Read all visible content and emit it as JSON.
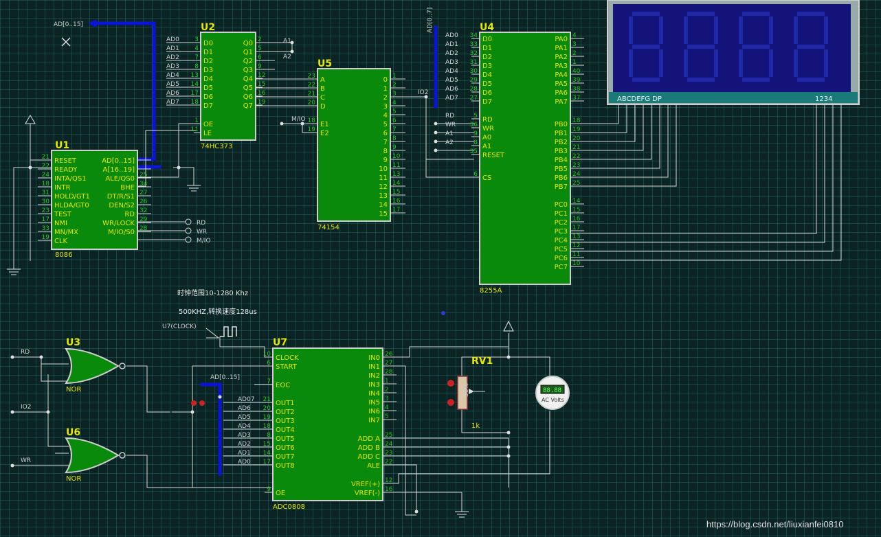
{
  "watermark": "https://blog.csdn.net/liuxianfei0810",
  "notes": {
    "clock_range": "时钟范围10-1280 Khz",
    "conversion": "500KHZ,转换速度128us"
  },
  "labels": {
    "bus_top_left": "AD[0..15]",
    "bus_adc": "AD[0..15]",
    "bus_u4": "AD[0..7]",
    "clock_src": "U7(CLOCK)",
    "io2_u5": "IO2",
    "io2_left": "IO2",
    "rd_left": "RD",
    "wr_left": "WR",
    "mio_u5": "M/IO",
    "a1_u2": "A1",
    "a2_u2": "A2",
    "rd_u1": "RD",
    "wr_u1": "WR",
    "mio_u1": "M/IO"
  },
  "u1": {
    "ref": "U1",
    "part": "8086",
    "left": [
      [
        "RESET",
        "21"
      ],
      [
        "READY",
        "22"
      ],
      [
        "INTA/QS1",
        "24"
      ],
      [
        "INTR",
        "18"
      ],
      [
        "HOLD/GT1",
        "31"
      ],
      [
        "HLDA/GT0",
        "30"
      ],
      [
        "TEST",
        "23"
      ],
      [
        "NMI",
        "17"
      ],
      [
        "MN/MX",
        "33"
      ],
      [
        "CLK",
        "19"
      ]
    ],
    "right": [
      [
        "AD[0..15]",
        ""
      ],
      [
        "A[16..19]",
        ""
      ],
      [
        "ALE/QS0",
        "25"
      ],
      [
        "BHE",
        "34"
      ],
      [
        "DT/R/S1",
        "27"
      ],
      [
        "DEN/S2",
        "26"
      ],
      [
        "RD",
        "32"
      ],
      [
        "WR/LOCK",
        "29"
      ],
      [
        "M/IO/S0",
        "28"
      ]
    ]
  },
  "u2": {
    "ref": "U2",
    "part": "74HC373",
    "left": [
      [
        "D0",
        "3",
        "AD0"
      ],
      [
        "D1",
        "4",
        "AD1"
      ],
      [
        "D2",
        "7",
        "AD2"
      ],
      [
        "D3",
        "8",
        "AD3"
      ],
      [
        "D4",
        "13",
        "AD4"
      ],
      [
        "D5",
        "14",
        "AD5"
      ],
      [
        "D6",
        "17",
        "AD6"
      ],
      [
        "D7",
        "18",
        "AD7"
      ]
    ],
    "right": [
      [
        "Q0",
        "2"
      ],
      [
        "Q1",
        "5"
      ],
      [
        "Q2",
        "6"
      ],
      [
        "Q3",
        "9"
      ],
      [
        "Q4",
        "12"
      ],
      [
        "Q5",
        "15"
      ],
      [
        "Q6",
        "16"
      ],
      [
        "Q7",
        "19"
      ]
    ],
    "ctrl": [
      [
        "OE",
        "1"
      ],
      [
        "LE",
        "11"
      ]
    ]
  },
  "u5": {
    "ref": "U5",
    "part": "74154",
    "left": [
      [
        "A",
        "23"
      ],
      [
        "B",
        "22"
      ],
      [
        "C",
        "21"
      ],
      [
        "D",
        "20"
      ],
      [
        "E1",
        "18"
      ],
      [
        "E2",
        "19"
      ]
    ],
    "right": [
      [
        "0",
        "1"
      ],
      [
        "1",
        "2"
      ],
      [
        "2",
        "3"
      ],
      [
        "3",
        "4"
      ],
      [
        "4",
        "5"
      ],
      [
        "5",
        "6"
      ],
      [
        "6",
        "7"
      ],
      [
        "7",
        "8"
      ],
      [
        "8",
        "9"
      ],
      [
        "9",
        "10"
      ],
      [
        "10",
        "11"
      ],
      [
        "11",
        "13"
      ],
      [
        "12",
        "14"
      ],
      [
        "13",
        "15"
      ],
      [
        "14",
        "16"
      ],
      [
        "15",
        "17"
      ]
    ]
  },
  "u4": {
    "ref": "U4",
    "part": "8255A",
    "left": [
      [
        "D0",
        "34",
        "AD0"
      ],
      [
        "D1",
        "33",
        "AD1"
      ],
      [
        "D2",
        "32",
        "AD2"
      ],
      [
        "D3",
        "31",
        "AD3"
      ],
      [
        "D4",
        "30",
        "AD4"
      ],
      [
        "D5",
        "29",
        "AD5"
      ],
      [
        "D6",
        "28",
        "AD6"
      ],
      [
        "D7",
        "27",
        "AD7"
      ]
    ],
    "ctrl": [
      [
        "RD",
        "5",
        "RD"
      ],
      [
        "WR",
        "36",
        "WR"
      ],
      [
        "A0",
        "9",
        "A1"
      ],
      [
        "A1",
        "8",
        "A2"
      ],
      [
        "RESET",
        "35",
        ""
      ],
      [
        "CS",
        "6",
        ""
      ]
    ],
    "pa": [
      [
        "PA0",
        "4"
      ],
      [
        "PA1",
        "3"
      ],
      [
        "PA2",
        "2"
      ],
      [
        "PA3",
        "1"
      ],
      [
        "PA4",
        "40"
      ],
      [
        "PA5",
        "39"
      ],
      [
        "PA6",
        "38"
      ],
      [
        "PA7",
        "37"
      ]
    ],
    "pb": [
      [
        "PB0",
        "18"
      ],
      [
        "PB1",
        "19"
      ],
      [
        "PB2",
        "20"
      ],
      [
        "PB3",
        "21"
      ],
      [
        "PB4",
        "22"
      ],
      [
        "PB5",
        "23"
      ],
      [
        "PB6",
        "24"
      ],
      [
        "PB7",
        "25"
      ]
    ],
    "pc": [
      [
        "PC0",
        "14"
      ],
      [
        "PC1",
        "15"
      ],
      [
        "PC2",
        "16"
      ],
      [
        "PC3",
        "17"
      ],
      [
        "PC4",
        "13"
      ],
      [
        "PC5",
        "12"
      ],
      [
        "PC6",
        "11"
      ],
      [
        "PC7",
        "10"
      ]
    ]
  },
  "u7": {
    "ref": "U7",
    "part": "ADC0808",
    "left": [
      [
        "CLOCK",
        "10",
        ""
      ],
      [
        "START",
        "6",
        ""
      ],
      [
        "EOC",
        "7",
        ""
      ],
      [
        "OUT1",
        "21",
        "AD07"
      ],
      [
        "OUT2",
        "20",
        "AD6"
      ],
      [
        "OUT3",
        "19",
        "AD5"
      ],
      [
        "OUT4",
        "18",
        "AD4"
      ],
      [
        "OUT5",
        "8",
        "AD3"
      ],
      [
        "OUT6",
        "15",
        "AD2"
      ],
      [
        "OUT7",
        "14",
        "AD1"
      ],
      [
        "OUT8",
        "17",
        "AD0"
      ],
      [
        "OE",
        "9",
        ""
      ]
    ],
    "right": [
      [
        "IN0",
        "26"
      ],
      [
        "IN1",
        "27"
      ],
      [
        "IN2",
        "28"
      ],
      [
        "IN3",
        "1"
      ],
      [
        "IN4",
        "2"
      ],
      [
        "IN5",
        "3"
      ],
      [
        "IN6",
        "4"
      ],
      [
        "IN7",
        "5"
      ],
      [
        "ADD A",
        "25"
      ],
      [
        "ADD B",
        "24"
      ],
      [
        "ADD C",
        "23"
      ],
      [
        "ALE",
        "22"
      ],
      [
        "VREF(+)",
        "12"
      ],
      [
        "VREF(-)",
        "16"
      ]
    ]
  },
  "u3": {
    "ref": "U3",
    "part": "NOR"
  },
  "u6": {
    "ref": "U6",
    "part": "NOR"
  },
  "rv1": {
    "ref": "RV1",
    "value": "1k",
    "body": "50%"
  },
  "voltmeter": {
    "reading": "88.88",
    "unit": "AC Volts"
  },
  "display": {
    "segments": "ABCDEFG  DP",
    "digits": "1234"
  },
  "colors": {
    "background": "#0b2323",
    "grid": "#1f6b6b",
    "chip": "#0a8a0a",
    "bus": "#0a14d8",
    "display": "#13137a"
  }
}
